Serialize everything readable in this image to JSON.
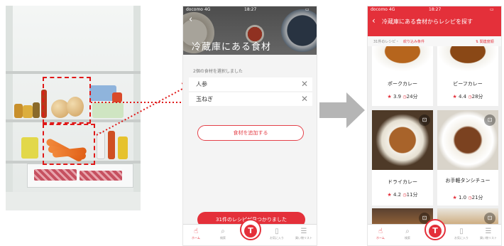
{
  "phone1": {
    "status_carrier": "docomo 4G",
    "status_time": "18:27",
    "hero_title": "冷蔵庫にある食材",
    "selected_label": "2個の食材を選択しました",
    "ingredients": [
      "人参",
      "玉ねぎ"
    ],
    "add_button": "食材を追加する",
    "found_button": "31件のレシピが見つかりました"
  },
  "phone2": {
    "status_carrier": "docomo 4G",
    "status_time": "18:27",
    "header_title": "冷蔵庫にある食材からレシピを探す",
    "result_count": "31件のレシピ・",
    "filter_label": "絞り込み条件",
    "sort_label": "⇅ 関連度順",
    "recipes": [
      {
        "name": "ポークカレー",
        "rating": "3.9",
        "time": "24分"
      },
      {
        "name": "ビーフカレー",
        "rating": "4.4",
        "time": "28分"
      },
      {
        "name": "ドライカレー",
        "rating": "4.2",
        "time": "11分"
      },
      {
        "name": "お手軽タンシチュー",
        "rating": "1.0",
        "time": "21分"
      }
    ]
  },
  "tabbar": {
    "home": "ホーム",
    "search": "検索",
    "favorites": "お気に入り",
    "shopping": "買い物リスト"
  },
  "colors": {
    "accent": "#e4303a",
    "arrow": "#b5b5b5",
    "highlight": "#e01818"
  }
}
